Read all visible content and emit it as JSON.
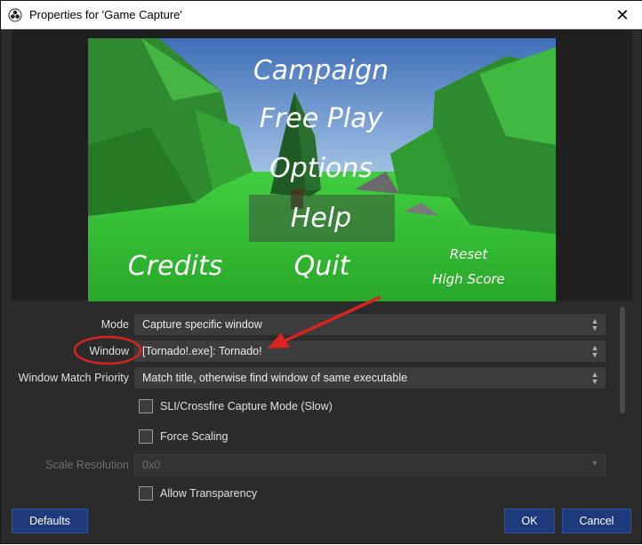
{
  "window": {
    "title": "Properties for 'Game Capture'",
    "close_glyph": "✕"
  },
  "preview": {
    "menu_items": [
      "Campaign",
      "Free Play",
      "Options",
      "Help",
      "Credits",
      "Quit"
    ],
    "reset_line1": "Reset",
    "reset_line2": "High Score"
  },
  "properties": {
    "mode": {
      "label": "Mode",
      "value": "Capture specific window"
    },
    "window": {
      "label": "Window",
      "value": "[Tornado!.exe]: Tornado!"
    },
    "priority": {
      "label": "Window Match Priority",
      "value": "Match title, otherwise find window of same executable"
    },
    "sli": {
      "label": "SLI/Crossfire Capture Mode (Slow)",
      "checked": false
    },
    "force_scaling": {
      "label": "Force Scaling",
      "checked": false
    },
    "scale_resolution": {
      "label": "Scale Resolution",
      "value": "0x0"
    },
    "allow_transparency": {
      "label": "Allow Transparency",
      "checked": false
    }
  },
  "buttons": {
    "defaults": "Defaults",
    "ok": "OK",
    "cancel": "Cancel"
  },
  "colors": {
    "background": "#2b2b2b",
    "field": "#3c3c3c",
    "button": "#1e3a7a",
    "annotation": "#d9231f"
  }
}
